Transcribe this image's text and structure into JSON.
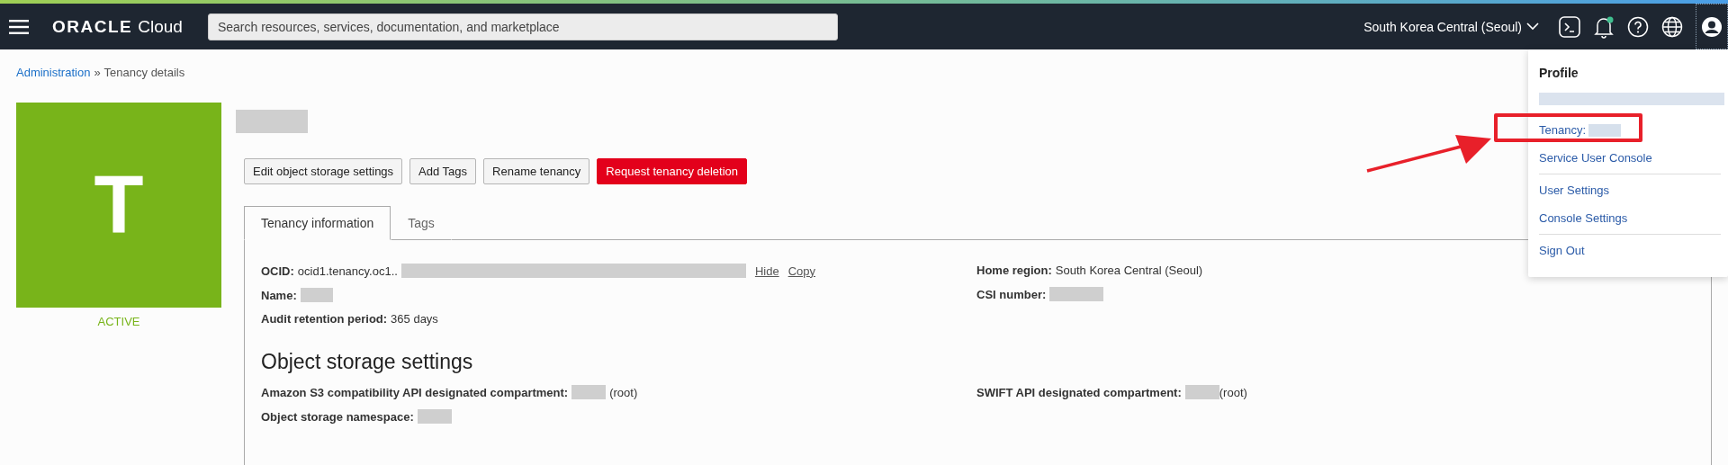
{
  "topbar": {
    "brand": "ORACLE",
    "product": "Cloud",
    "search": {
      "placeholder": "Search resources, services, documentation, and marketplace"
    },
    "region": "South Korea Central (Seoul)",
    "notification_dot": true
  },
  "breadcrumb": {
    "link": "Administration",
    "separator": "»",
    "current": "Tenancy details"
  },
  "tenancy": {
    "initial": "T",
    "status": "ACTIVE",
    "name_redacted": true
  },
  "buttons": [
    {
      "label": "Edit object storage settings",
      "kind": "default"
    },
    {
      "label": "Add Tags",
      "kind": "default"
    },
    {
      "label": "Rename tenancy",
      "kind": "default"
    },
    {
      "label": "Request tenancy deletion",
      "kind": "danger"
    }
  ],
  "tabs": [
    {
      "label": "Tenancy information",
      "selected": true
    },
    {
      "label": "Tags",
      "selected": false
    }
  ],
  "info_left": [
    {
      "label": "OCID:",
      "value": "ocid1.tenancy.oc1..",
      "redacted": true,
      "links": [
        "Hide",
        "Copy"
      ]
    },
    {
      "label": "Name:",
      "redacted": true
    },
    {
      "label": "Audit retention period:",
      "value": "365 days",
      "redacted": false
    }
  ],
  "info_right": [
    {
      "label": "Home region:",
      "value": "South Korea Central (Seoul)",
      "redacted": false
    },
    {
      "label": "CSI number:",
      "redacted": true
    }
  ],
  "object_storage": {
    "heading": "Object storage settings",
    "left": [
      {
        "label": "Amazon S3 compatibility API designated compartment:",
        "value": "(root)",
        "redacted": true
      },
      {
        "label": "Object storage namespace:",
        "redacted": true
      }
    ],
    "right": [
      {
        "label": "SWIFT API designated compartment:",
        "value": "(root)",
        "redacted": true
      }
    ]
  },
  "profile_menu": {
    "title": "Profile",
    "user_redacted": true,
    "groups": [
      {
        "items": [
          {
            "label": "Tenancy:",
            "redacted": true,
            "annotated": true
          },
          {
            "label": "Service User Console",
            "redacted": false,
            "annotated": false
          }
        ]
      },
      {
        "items": [
          {
            "label": "User Settings",
            "redacted": false,
            "annotated": false
          },
          {
            "label": "Console Settings",
            "redacted": false,
            "annotated": false
          }
        ]
      },
      {
        "items": [
          {
            "label": "Sign Out",
            "redacted": false,
            "annotated": false
          }
        ]
      }
    ]
  }
}
